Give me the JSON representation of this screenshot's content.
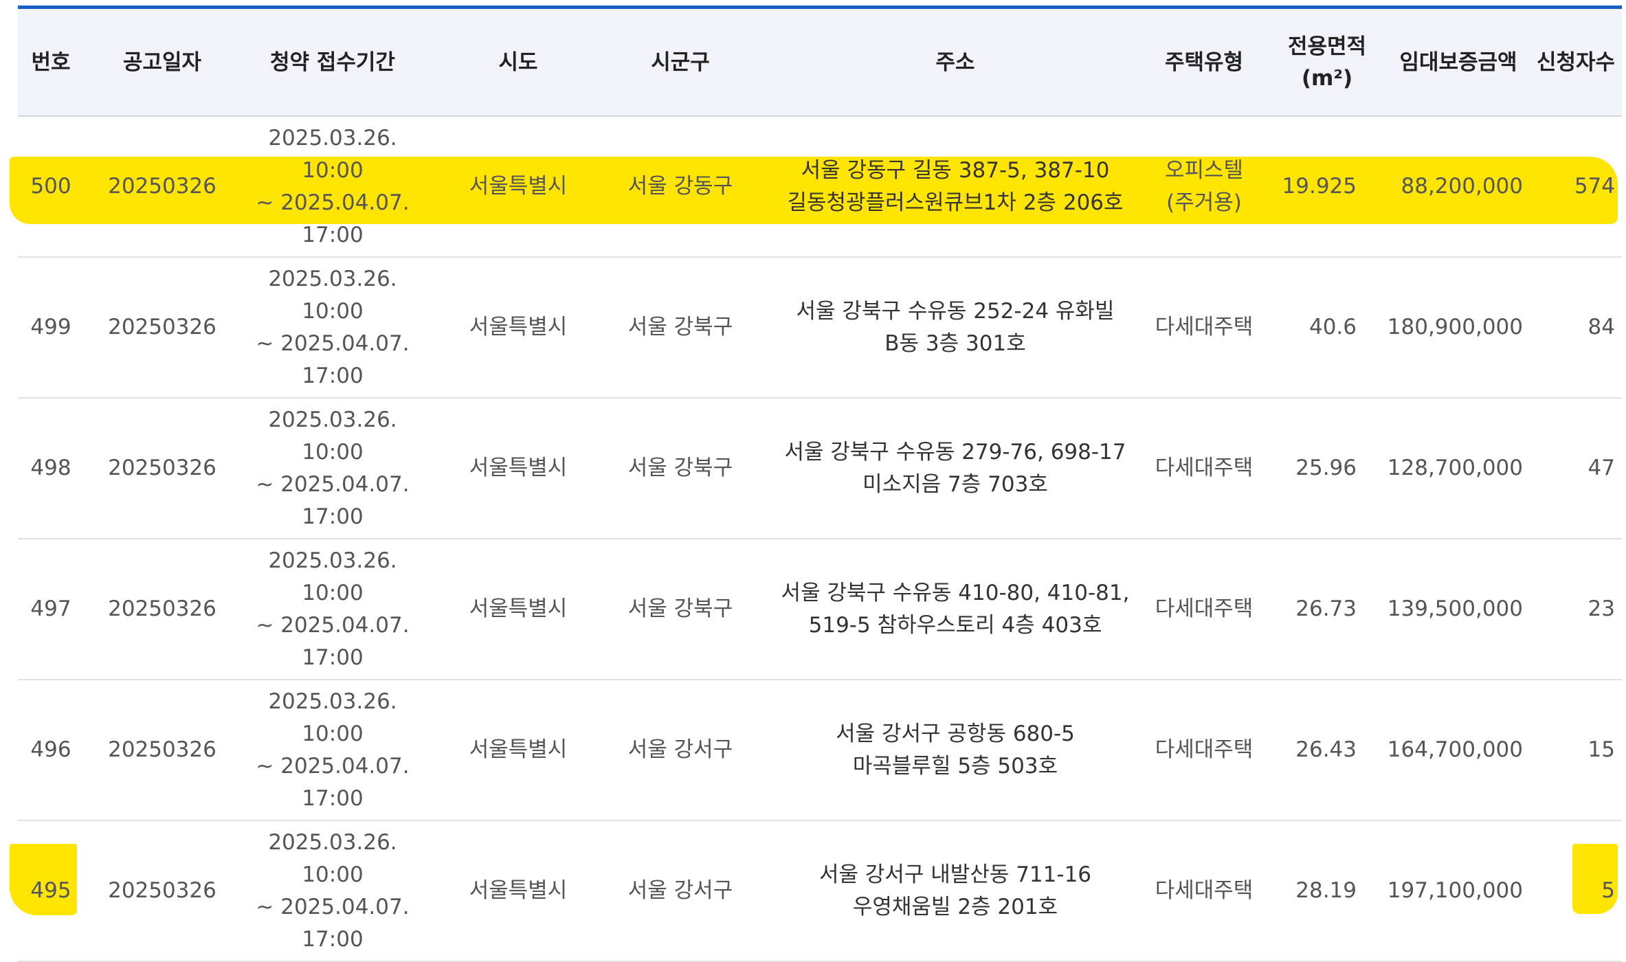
{
  "highlight_color": "#ffe500",
  "accent_color": "#1a5fc8",
  "columns": {
    "no": "번호",
    "date": "공고일자",
    "period": "청약 접수기간",
    "sido": "시도",
    "sigungu": "시군구",
    "address": "주소",
    "type": "주택유형",
    "area_line1": "전용면적",
    "area_line2": "(m²)",
    "deposit": "임대보증금액",
    "applicants": "신청자수"
  },
  "rows": [
    {
      "no": "500",
      "date": "20250326",
      "period1": "2025.03.26. 10:00",
      "period2": "~ 2025.04.07.",
      "period3": "17:00",
      "sido": "서울특별시",
      "sigungu": "서울 강동구",
      "addr1": "서울 강동구 길동 387-5, 387-10",
      "addr2": "길동청광플러스원큐브1차 2층 206호",
      "type1": "오피스텔",
      "type2": "(주거용)",
      "area": "19.925",
      "deposit": "88,200,000",
      "applicants": "574"
    },
    {
      "no": "499",
      "date": "20250326",
      "period1": "2025.03.26. 10:00",
      "period2": "~ 2025.04.07.",
      "period3": "17:00",
      "sido": "서울특별시",
      "sigungu": "서울 강북구",
      "addr1": "서울 강북구 수유동 252-24 유화빌",
      "addr2": "B동 3층 301호",
      "type1": "다세대주택",
      "type2": "",
      "area": "40.6",
      "deposit": "180,900,000",
      "applicants": "84"
    },
    {
      "no": "498",
      "date": "20250326",
      "period1": "2025.03.26. 10:00",
      "period2": "~ 2025.04.07.",
      "period3": "17:00",
      "sido": "서울특별시",
      "sigungu": "서울 강북구",
      "addr1": "서울 강북구 수유동 279-76, 698-17",
      "addr2": "미소지음 7층 703호",
      "type1": "다세대주택",
      "type2": "",
      "area": "25.96",
      "deposit": "128,700,000",
      "applicants": "47"
    },
    {
      "no": "497",
      "date": "20250326",
      "period1": "2025.03.26. 10:00",
      "period2": "~ 2025.04.07.",
      "period3": "17:00",
      "sido": "서울특별시",
      "sigungu": "서울 강북구",
      "addr1": "서울 강북구 수유동 410-80, 410-81,",
      "addr2": "519-5 참하우스토리 4층 403호",
      "type1": "다세대주택",
      "type2": "",
      "area": "26.73",
      "deposit": "139,500,000",
      "applicants": "23"
    },
    {
      "no": "496",
      "date": "20250326",
      "period1": "2025.03.26. 10:00",
      "period2": "~ 2025.04.07.",
      "period3": "17:00",
      "sido": "서울특별시",
      "sigungu": "서울 강서구",
      "addr1": "서울 강서구 공항동 680-5",
      "addr2": "마곡블루힐 5층 503호",
      "type1": "다세대주택",
      "type2": "",
      "area": "26.43",
      "deposit": "164,700,000",
      "applicants": "15"
    },
    {
      "no": "495",
      "date": "20250326",
      "period1": "2025.03.26. 10:00",
      "period2": "~ 2025.04.07.",
      "period3": "17:00",
      "sido": "서울특별시",
      "sigungu": "서울 강서구",
      "addr1": "서울 강서구 내발산동 711-16",
      "addr2": "우영채움빌 2층 201호",
      "type1": "다세대주택",
      "type2": "",
      "area": "28.19",
      "deposit": "197,100,000",
      "applicants": "5"
    }
  ]
}
